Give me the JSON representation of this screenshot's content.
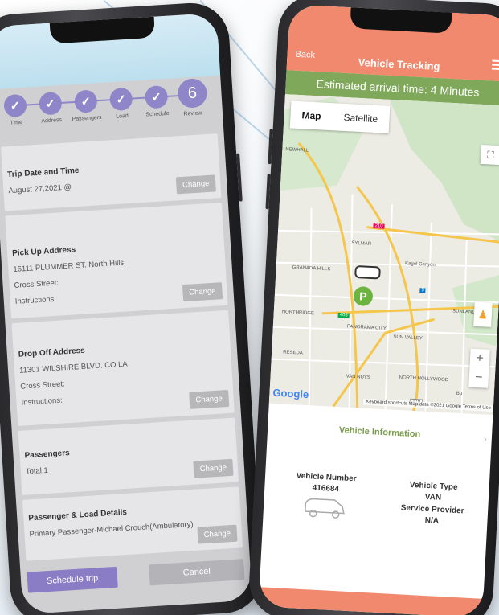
{
  "left_screen": {
    "steps": [
      {
        "label": "Time",
        "done": true
      },
      {
        "label": "Address",
        "done": true
      },
      {
        "label": "Passengers",
        "done": true
      },
      {
        "label": "Load",
        "done": true
      },
      {
        "label": "Schedule",
        "done": true
      },
      {
        "label": "Review",
        "number": "6",
        "done": false
      }
    ],
    "check_glyph": "✓",
    "sections": {
      "trip": {
        "title": "Trip Date and Time",
        "value": "August 27,2021 @",
        "change_label": "Change"
      },
      "pickup": {
        "title": "Pick Up Address",
        "address": "16111 PLUMMER ST. North Hills",
        "cross_street": "Cross Street:",
        "instructions": "Instructions:",
        "change_label": "Change"
      },
      "dropoff": {
        "title": "Drop Off Address",
        "address": "11301 WILSHIRE BLVD. CO LA",
        "cross_street": "Cross Street:",
        "instructions": "Instructions:",
        "change_label": "Change"
      },
      "passengers": {
        "title": "Passengers",
        "total": "Total:1",
        "change_label": "Change"
      },
      "load": {
        "title": "Passenger & Load Details",
        "primary": "Primary Passenger-Michael Crouch(Ambulatory)",
        "change_label": "Change"
      }
    },
    "buttons": {
      "schedule": "Schedule trip",
      "cancel": "Cancel"
    },
    "colors": {
      "accent": "#8f86c9",
      "button_gray": "#b7b7ba"
    }
  },
  "right_screen": {
    "back_label": "Back",
    "title": "Vehicle Tracking",
    "eta": "Estimated arrival time: 4 Minutes",
    "map": {
      "tabs": [
        "Map",
        "Satellite"
      ],
      "active_tab": "Map",
      "places": [
        "NEWHALL",
        "SYLMAR",
        "Kagel Canyon",
        "GRANADA HILLS",
        "NORTHRIDGE",
        "PANORAMA CITY",
        "SUN VALLEY",
        "RESEDA",
        "VAN NUYS",
        "NORTH HOLLYWOOD",
        "SUNLAND",
        "Bu"
      ],
      "route_shields": [
        "210",
        "405",
        "5",
        "170"
      ],
      "pickup_marker": "P",
      "logo": "Google",
      "attribution": "Keyboard shortcuts   Map data ©2021 Google   Terms of Use",
      "zoom_in": "+",
      "zoom_out": "−"
    },
    "vehicle_info": {
      "title": "Vehicle Information",
      "number_label": "Vehicle Number",
      "number_value": "416684",
      "type_label": "Vehicle Type",
      "type_value": "VAN",
      "provider_label": "Service Provider",
      "provider_value": "N/A"
    },
    "colors": {
      "header": "#f0896e",
      "eta_bar": "#7fa85a"
    }
  }
}
